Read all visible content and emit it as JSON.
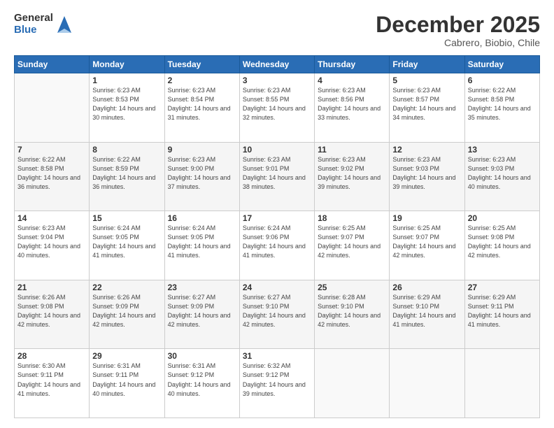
{
  "logo": {
    "general": "General",
    "blue": "Blue"
  },
  "title": "December 2025",
  "subtitle": "Cabrero, Biobio, Chile",
  "headers": [
    "Sunday",
    "Monday",
    "Tuesday",
    "Wednesday",
    "Thursday",
    "Friday",
    "Saturday"
  ],
  "weeks": [
    [
      {
        "day": "",
        "sunrise": "",
        "sunset": "",
        "daylight": ""
      },
      {
        "day": "1",
        "sunrise": "Sunrise: 6:23 AM",
        "sunset": "Sunset: 8:53 PM",
        "daylight": "Daylight: 14 hours and 30 minutes."
      },
      {
        "day": "2",
        "sunrise": "Sunrise: 6:23 AM",
        "sunset": "Sunset: 8:54 PM",
        "daylight": "Daylight: 14 hours and 31 minutes."
      },
      {
        "day": "3",
        "sunrise": "Sunrise: 6:23 AM",
        "sunset": "Sunset: 8:55 PM",
        "daylight": "Daylight: 14 hours and 32 minutes."
      },
      {
        "day": "4",
        "sunrise": "Sunrise: 6:23 AM",
        "sunset": "Sunset: 8:56 PM",
        "daylight": "Daylight: 14 hours and 33 minutes."
      },
      {
        "day": "5",
        "sunrise": "Sunrise: 6:23 AM",
        "sunset": "Sunset: 8:57 PM",
        "daylight": "Daylight: 14 hours and 34 minutes."
      },
      {
        "day": "6",
        "sunrise": "Sunrise: 6:22 AM",
        "sunset": "Sunset: 8:58 PM",
        "daylight": "Daylight: 14 hours and 35 minutes."
      }
    ],
    [
      {
        "day": "7",
        "sunrise": "Sunrise: 6:22 AM",
        "sunset": "Sunset: 8:58 PM",
        "daylight": "Daylight: 14 hours and 36 minutes."
      },
      {
        "day": "8",
        "sunrise": "Sunrise: 6:22 AM",
        "sunset": "Sunset: 8:59 PM",
        "daylight": "Daylight: 14 hours and 36 minutes."
      },
      {
        "day": "9",
        "sunrise": "Sunrise: 6:23 AM",
        "sunset": "Sunset: 9:00 PM",
        "daylight": "Daylight: 14 hours and 37 minutes."
      },
      {
        "day": "10",
        "sunrise": "Sunrise: 6:23 AM",
        "sunset": "Sunset: 9:01 PM",
        "daylight": "Daylight: 14 hours and 38 minutes."
      },
      {
        "day": "11",
        "sunrise": "Sunrise: 6:23 AM",
        "sunset": "Sunset: 9:02 PM",
        "daylight": "Daylight: 14 hours and 39 minutes."
      },
      {
        "day": "12",
        "sunrise": "Sunrise: 6:23 AM",
        "sunset": "Sunset: 9:03 PM",
        "daylight": "Daylight: 14 hours and 39 minutes."
      },
      {
        "day": "13",
        "sunrise": "Sunrise: 6:23 AM",
        "sunset": "Sunset: 9:03 PM",
        "daylight": "Daylight: 14 hours and 40 minutes."
      }
    ],
    [
      {
        "day": "14",
        "sunrise": "Sunrise: 6:23 AM",
        "sunset": "Sunset: 9:04 PM",
        "daylight": "Daylight: 14 hours and 40 minutes."
      },
      {
        "day": "15",
        "sunrise": "Sunrise: 6:24 AM",
        "sunset": "Sunset: 9:05 PM",
        "daylight": "Daylight: 14 hours and 41 minutes."
      },
      {
        "day": "16",
        "sunrise": "Sunrise: 6:24 AM",
        "sunset": "Sunset: 9:05 PM",
        "daylight": "Daylight: 14 hours and 41 minutes."
      },
      {
        "day": "17",
        "sunrise": "Sunrise: 6:24 AM",
        "sunset": "Sunset: 9:06 PM",
        "daylight": "Daylight: 14 hours and 41 minutes."
      },
      {
        "day": "18",
        "sunrise": "Sunrise: 6:25 AM",
        "sunset": "Sunset: 9:07 PM",
        "daylight": "Daylight: 14 hours and 42 minutes."
      },
      {
        "day": "19",
        "sunrise": "Sunrise: 6:25 AM",
        "sunset": "Sunset: 9:07 PM",
        "daylight": "Daylight: 14 hours and 42 minutes."
      },
      {
        "day": "20",
        "sunrise": "Sunrise: 6:25 AM",
        "sunset": "Sunset: 9:08 PM",
        "daylight": "Daylight: 14 hours and 42 minutes."
      }
    ],
    [
      {
        "day": "21",
        "sunrise": "Sunrise: 6:26 AM",
        "sunset": "Sunset: 9:08 PM",
        "daylight": "Daylight: 14 hours and 42 minutes."
      },
      {
        "day": "22",
        "sunrise": "Sunrise: 6:26 AM",
        "sunset": "Sunset: 9:09 PM",
        "daylight": "Daylight: 14 hours and 42 minutes."
      },
      {
        "day": "23",
        "sunrise": "Sunrise: 6:27 AM",
        "sunset": "Sunset: 9:09 PM",
        "daylight": "Daylight: 14 hours and 42 minutes."
      },
      {
        "day": "24",
        "sunrise": "Sunrise: 6:27 AM",
        "sunset": "Sunset: 9:10 PM",
        "daylight": "Daylight: 14 hours and 42 minutes."
      },
      {
        "day": "25",
        "sunrise": "Sunrise: 6:28 AM",
        "sunset": "Sunset: 9:10 PM",
        "daylight": "Daylight: 14 hours and 42 minutes."
      },
      {
        "day": "26",
        "sunrise": "Sunrise: 6:29 AM",
        "sunset": "Sunset: 9:10 PM",
        "daylight": "Daylight: 14 hours and 41 minutes."
      },
      {
        "day": "27",
        "sunrise": "Sunrise: 6:29 AM",
        "sunset": "Sunset: 9:11 PM",
        "daylight": "Daylight: 14 hours and 41 minutes."
      }
    ],
    [
      {
        "day": "28",
        "sunrise": "Sunrise: 6:30 AM",
        "sunset": "Sunset: 9:11 PM",
        "daylight": "Daylight: 14 hours and 41 minutes."
      },
      {
        "day": "29",
        "sunrise": "Sunrise: 6:31 AM",
        "sunset": "Sunset: 9:11 PM",
        "daylight": "Daylight: 14 hours and 40 minutes."
      },
      {
        "day": "30",
        "sunrise": "Sunrise: 6:31 AM",
        "sunset": "Sunset: 9:12 PM",
        "daylight": "Daylight: 14 hours and 40 minutes."
      },
      {
        "day": "31",
        "sunrise": "Sunrise: 6:32 AM",
        "sunset": "Sunset: 9:12 PM",
        "daylight": "Daylight: 14 hours and 39 minutes."
      },
      {
        "day": "",
        "sunrise": "",
        "sunset": "",
        "daylight": ""
      },
      {
        "day": "",
        "sunrise": "",
        "sunset": "",
        "daylight": ""
      },
      {
        "day": "",
        "sunrise": "",
        "sunset": "",
        "daylight": ""
      }
    ]
  ]
}
